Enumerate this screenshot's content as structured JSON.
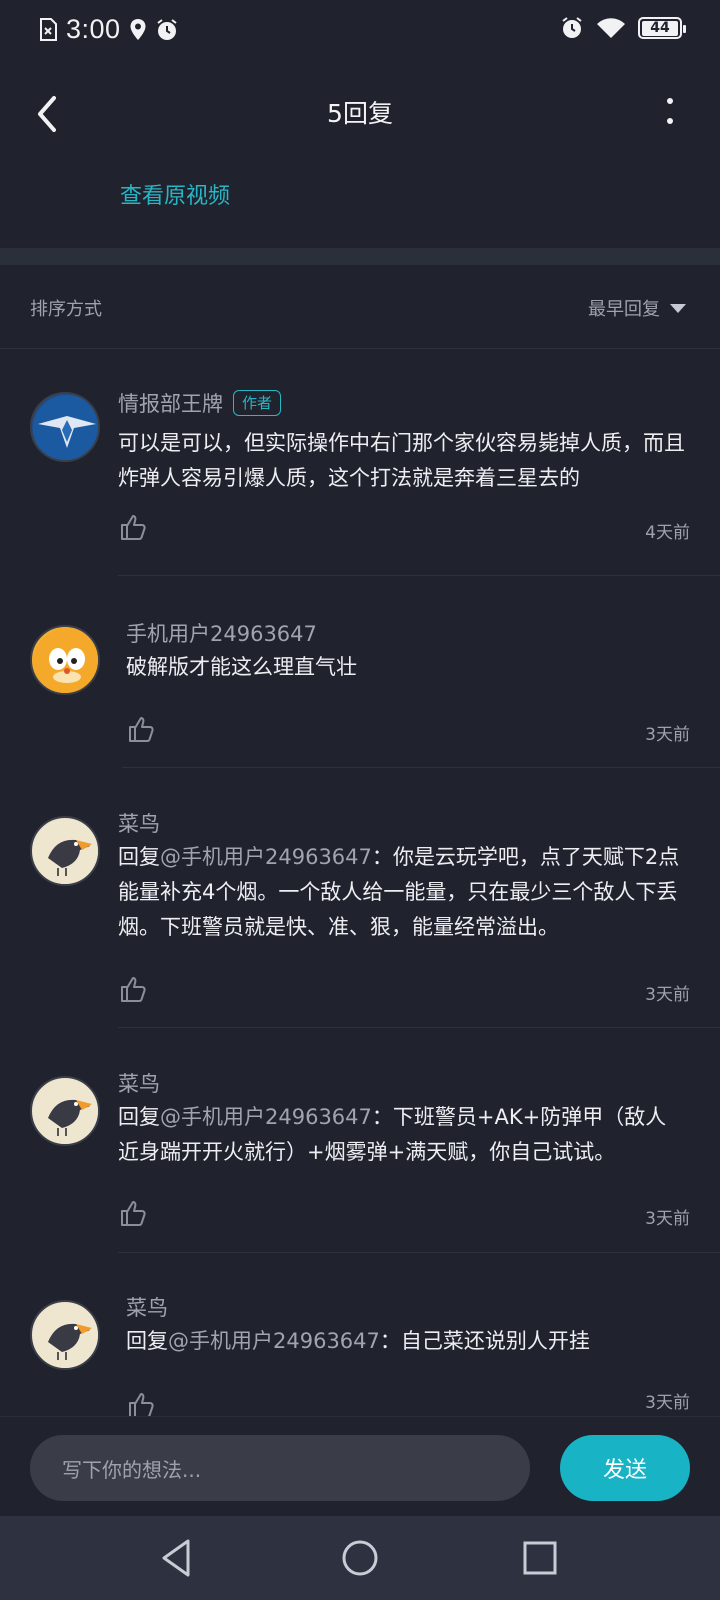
{
  "status_bar": {
    "time": "3:00",
    "battery": "44"
  },
  "header": {
    "title": "5回复",
    "view_original_video": "查看原视频"
  },
  "sort": {
    "label": "排序方式",
    "value": "最早回复"
  },
  "comments": [
    {
      "name": "情报部王牌",
      "badge": "作者",
      "text": " 可以是可以，但实际操作中右门那个家伙容易毙掉人质，而且炸弹人容易引爆人质，这个打法就是奔着三星去的",
      "time": "4天前"
    },
    {
      "name": "手机用户24963647",
      "text": "破解版才能这么理直气壮",
      "time": "3天前"
    },
    {
      "name": "菜鸟",
      "reply_prefix": "回复",
      "mention": "@手机用户24963647",
      "text": "：你是云玩学吧，点了天赋下2点能量补充4个烟。一个敌人给一能量，只在最少三个敌人下丢烟。下班警员就是快、准、狠，能量经常溢出。",
      "time": "3天前"
    },
    {
      "name": "菜鸟",
      "reply_prefix": "回复",
      "mention": "@手机用户24963647",
      "text": "：下班警员+AK+防弹甲（敌人近身踹开开火就行）+烟雾弹+满天赋，你自己试试。",
      "time": "3天前"
    },
    {
      "name": "菜鸟",
      "reply_prefix": "回复",
      "mention": "@手机用户24963647",
      "text": "：自己菜还说别人开挂",
      "time": "3天前"
    }
  ],
  "input": {
    "placeholder": "写下你的想法...",
    "send_label": "发送"
  },
  "icons": [
    "back-icon",
    "more-icon",
    "like-icon",
    "sort-dropdown-icon",
    "nav-back-icon",
    "nav-home-icon",
    "nav-recents-icon"
  ],
  "colors": {
    "accent": "#18b3c4",
    "background": "#20232d"
  }
}
